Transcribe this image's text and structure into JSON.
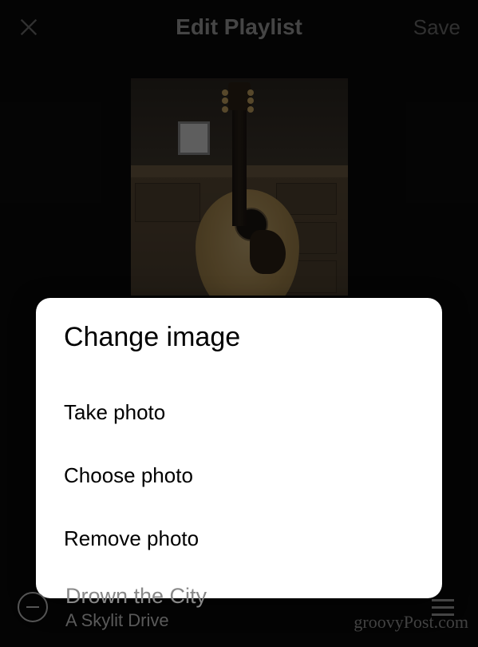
{
  "header": {
    "title": "Edit Playlist",
    "save_label": "Save"
  },
  "cover": {
    "alt": "Acoustic guitar in room"
  },
  "modal": {
    "title": "Change image",
    "options": {
      "take": "Take photo",
      "choose": "Choose photo",
      "remove": "Remove photo"
    }
  },
  "track": {
    "title": "Drown the City",
    "artist": "A Skylit Drive"
  },
  "watermark": "groovyPost.com"
}
